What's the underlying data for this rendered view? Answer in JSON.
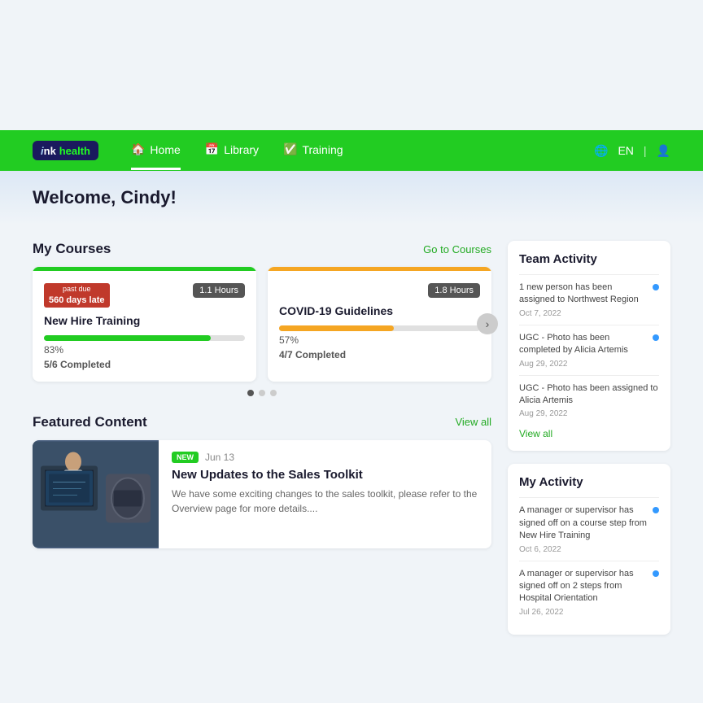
{
  "top_space": true,
  "navbar": {
    "logo": {
      "ink": "nk",
      "health": "health"
    },
    "nav_items": [
      {
        "label": "Home",
        "icon": "🏠",
        "active": true
      },
      {
        "label": "Library",
        "icon": "📅",
        "active": false
      },
      {
        "label": "Training",
        "icon": "✅",
        "active": false
      }
    ],
    "language": "EN",
    "user_icon": "👤"
  },
  "welcome": {
    "greeting": "Welcome, Cindy!"
  },
  "my_courses": {
    "title": "My Courses",
    "link_label": "Go to Courses",
    "courses": [
      {
        "id": "course-1",
        "past_due_label": "past due",
        "past_due_days": "560 days late",
        "hours": "1.1 Hours",
        "name": "New Hire Training",
        "progress_pct": 83,
        "progress_label": "83%",
        "completed_label": "5/6 Completed",
        "bar_color": "green"
      },
      {
        "id": "course-2",
        "hours": "1.8 Hours",
        "name": "COVID-19 Guidelines",
        "progress_pct": 57,
        "progress_label": "57%",
        "completed_label": "4/7 Completed",
        "bar_color": "orange"
      }
    ],
    "carousel_dots": [
      true,
      false,
      false
    ]
  },
  "featured_content": {
    "title": "Featured Content",
    "link_label": "View all",
    "item": {
      "badge": "NEW",
      "date": "Jun 13",
      "title": "New Updates to the Sales Toolkit",
      "description": "We have some exciting changes to the sales toolkit, please refer to the Overview page for more details...."
    }
  },
  "team_activity": {
    "title": "Team Activity",
    "items": [
      {
        "text": "1 new person has been assigned to Northwest Region",
        "date": "Oct 7, 2022",
        "dot": true
      },
      {
        "text": "UGC - Photo has been completed by Alicia Artemis",
        "date": "Aug 29, 2022",
        "dot": true
      },
      {
        "text": "UGC - Photo has been assigned to Alicia Artemis",
        "date": "Aug 29, 2022",
        "dot": false
      }
    ],
    "view_all_label": "View all"
  },
  "my_activity": {
    "title": "My Activity",
    "items": [
      {
        "text": "A manager or supervisor has signed off on a course step from New Hire Training",
        "date": "Oct 6, 2022",
        "dot": true
      },
      {
        "text": "A manager or supervisor has signed off on 2 steps from Hospital Orientation",
        "date": "Jul 26, 2022",
        "dot": true
      }
    ]
  }
}
